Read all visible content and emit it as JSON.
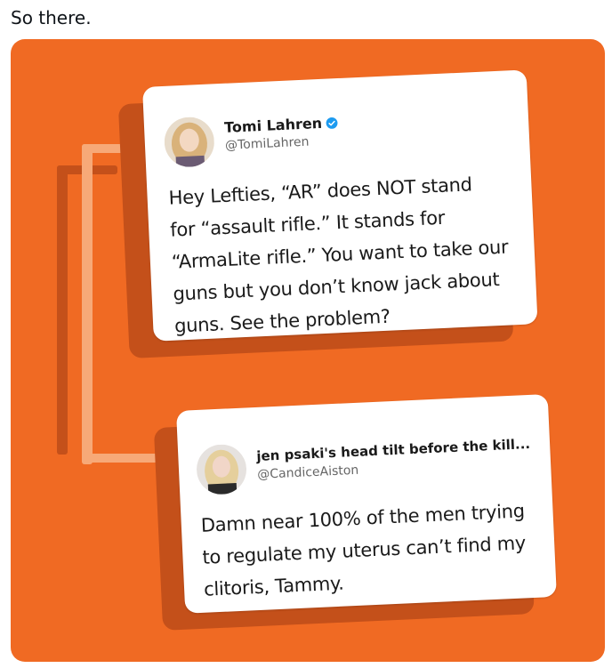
{
  "post": {
    "text": "So there."
  },
  "tweets": [
    {
      "name": "Tomi Lahren",
      "handle": "@TomiLahren",
      "verified": true,
      "lines": [
        "Hey Lefties, “AR” does NOT stand",
        "for “assault rifle.” It stands for",
        "“ArmaLite rifle.” You want to take our",
        "guns but you don’t know jack about",
        "guns. See the problem?"
      ]
    },
    {
      "name": "jen psaki's head tilt before the kill...",
      "handle": "@CandiceAiston",
      "verified": false,
      "lines": [
        "Damn near 100% of the men trying",
        "to regulate my uterus can’t find my",
        "clitoris, Tammy."
      ]
    }
  ],
  "colors": {
    "background": "#f06a23",
    "shadow": "#c4501a",
    "connector": "#f7a978",
    "verified": "#1d9bf0"
  }
}
